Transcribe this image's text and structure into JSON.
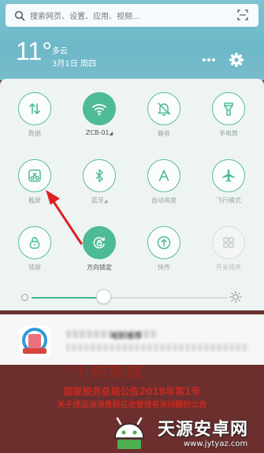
{
  "search": {
    "placeholder": "搜索网页、设置、应用、视频..."
  },
  "weather": {
    "temperature": "11°",
    "condition": "多云",
    "date": "3月1日 周四"
  },
  "tiles": [
    {
      "label": "数据",
      "on": false,
      "icon": "data-arrows-icon"
    },
    {
      "label": "ZCB-01",
      "on": true,
      "icon": "wifi-icon",
      "has_more": true
    },
    {
      "label": "静音",
      "on": false,
      "icon": "bell-off-icon"
    },
    {
      "label": "手电筒",
      "on": false,
      "icon": "flashlight-icon"
    },
    {
      "label": "截屏",
      "on": false,
      "icon": "scissors-icon"
    },
    {
      "label": "蓝牙",
      "on": false,
      "icon": "bluetooth-icon",
      "has_more": true
    },
    {
      "label": "自动亮度",
      "on": false,
      "icon": "auto-brightness-icon"
    },
    {
      "label": "飞行模式",
      "on": false,
      "icon": "airplane-icon"
    },
    {
      "label": "锁屏",
      "on": false,
      "icon": "lock-icon"
    },
    {
      "label": "方向锁定",
      "on": true,
      "icon": "rotation-lock-icon"
    },
    {
      "label": "快传",
      "on": false,
      "icon": "quick-transfer-icon"
    },
    {
      "label": "开关排序",
      "on": false,
      "icon": "grid-sort-icon"
    }
  ],
  "brightness": {
    "level": 0.37
  },
  "notification": {
    "title": "电影推荐"
  },
  "document": {
    "header": "个税提醒",
    "line1": "国家税务总局公告2018年第1号",
    "line2": "关于成品油消费税征收管理有关问题的公告"
  },
  "watermark": {
    "brand": "天源安卓网",
    "url": "www.jytyaz.com"
  },
  "colors": {
    "accent": "#4dbb93",
    "sky": "#7bc3d0",
    "doc_red": "#c62a20"
  }
}
